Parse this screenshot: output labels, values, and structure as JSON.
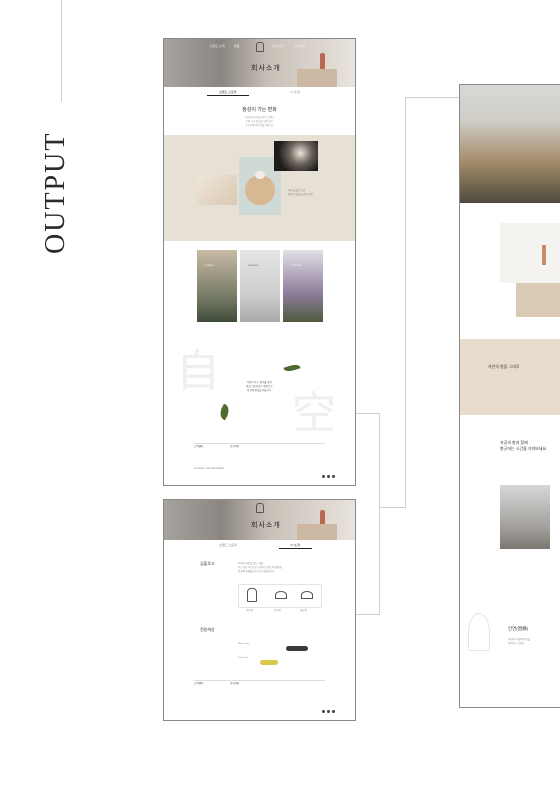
{
  "side_title": "OUTPUT",
  "mockups": {
    "main": {
      "hero_title": "회사소개",
      "nav": [
        "브랜드 소개",
        "제품",
        "회사소개",
        "고객센터"
      ],
      "tabs": [
        "브랜드 스토리",
        "CI 소개"
      ],
      "subhead": "정성이 가는 변화",
      "body_lines": [
        "자연에서 영감을 받은 브랜드",
        "오랜 시간 정성을 담아 만든",
        "우리만의 이야기를 전합니다"
      ],
      "beige_caption": [
        "자연을 닮은 공간",
        "편안한 일상을 위한 제안"
      ],
      "card_captions": [
        "SPRING",
        "SUMMER",
        "AUTUMN"
      ],
      "hanja_1": "自",
      "hanja_2": "空",
      "quote_lines": [
        "자연이 주는 위로를 담아",
        "정성스럽게 만든 제품으로",
        "당신의 일상을 채웁니다"
      ],
      "footer_headings": [
        "고객센터",
        "공지사항"
      ],
      "footer_brand": "ZAGONG · BRAND STORY"
    },
    "ci": {
      "hero_title": "회사소개",
      "tabs": [
        "브랜드 스토리",
        "CI 소개"
      ],
      "section_1": "심볼로고",
      "section_2": "전용색상",
      "body_lines": [
        "자연과 사람을 잇는 심볼",
        "부드러운 곡선으로 표현한 브랜드의 정체성",
        "연꽃의 형태를 모티브로 하였습니다"
      ],
      "logo_labels": [
        "기본형",
        "가로형",
        "세로형"
      ],
      "color_labels": [
        "Main Color",
        "Sub Color",
        "Point Color"
      ],
      "colors": {
        "main": "#3a3a3a",
        "point": "#d8c94a"
      },
      "footer_headings": [
        "고객센터",
        "공지사항"
      ]
    },
    "detail": {
      "block_title": "자연의 향을 그대로",
      "text_title_1": "자공의 향과 함께",
      "text_title_2": "향긋하는 시간을 가져보세요.",
      "lotus_title": "인연(因緣)",
      "lotus_lines": [
        "자연과 사람의 인연을",
        "이어주는 브랜드"
      ]
    }
  },
  "colors": {
    "beige": "#e7e0d5",
    "tan": "#dac9b5",
    "border": "#888888"
  }
}
